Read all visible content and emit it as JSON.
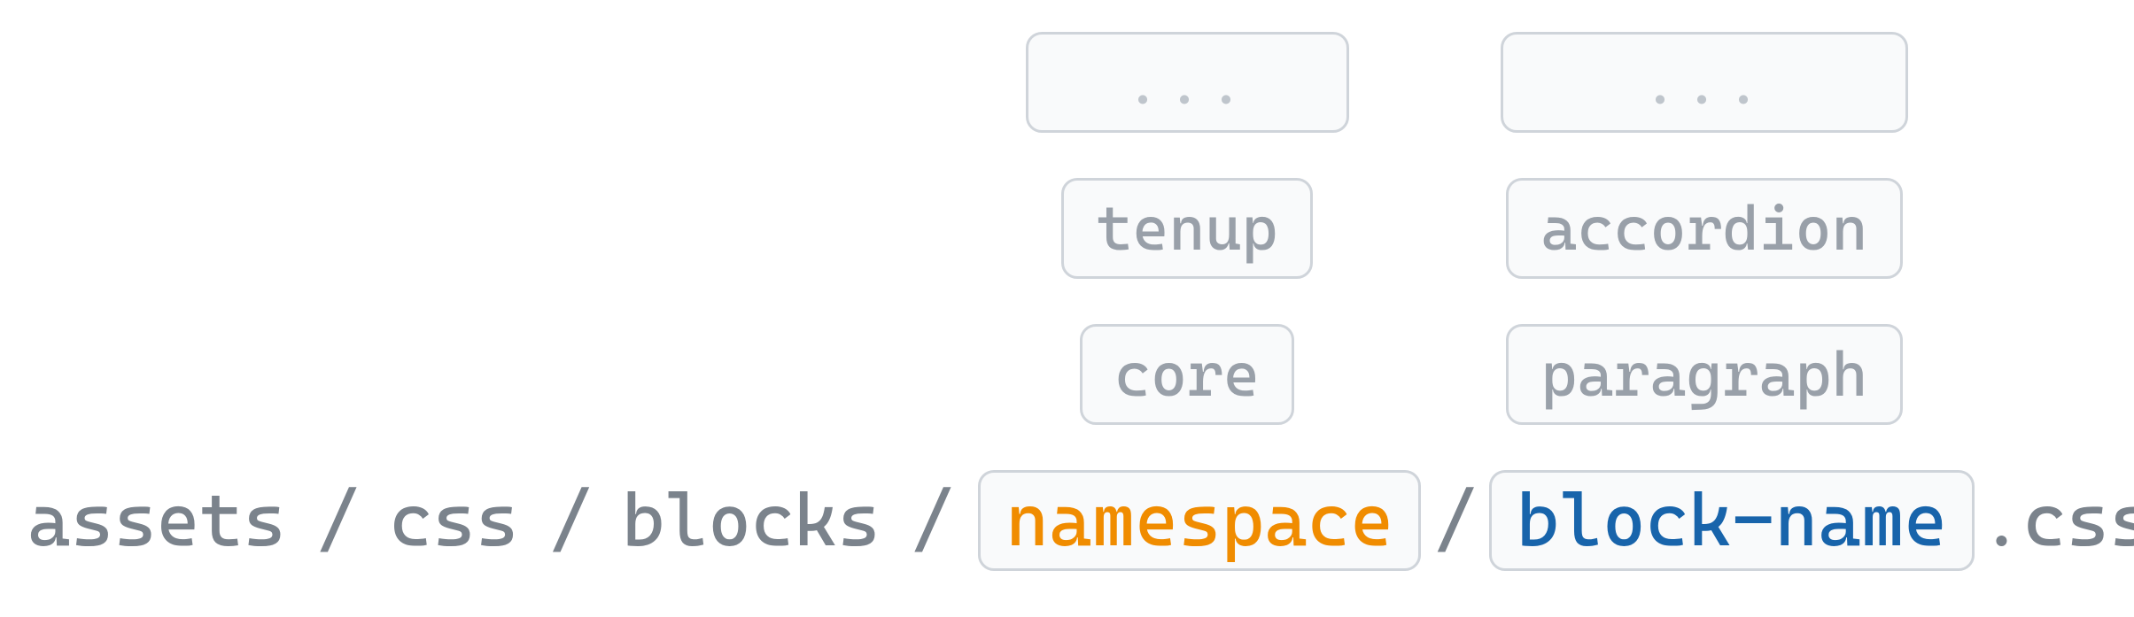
{
  "path": {
    "segments": [
      "assets",
      "css",
      "blocks"
    ],
    "namespace_placeholder": "namespace",
    "blockname_placeholder": "block-name",
    "extension": ".css"
  },
  "namespace_examples": {
    "ellipsis": "...",
    "row1": "tenup",
    "row2": "core"
  },
  "blockname_examples": {
    "ellipsis": "...",
    "row1": "accordion",
    "row2": "paragraph"
  },
  "colors": {
    "namespace": "#f08c00",
    "blockname": "#1864ab",
    "path_text": "#7b838c",
    "box_bg": "#f9fafb",
    "box_border": "#cfd4da",
    "box_text": "#99a0a9"
  }
}
